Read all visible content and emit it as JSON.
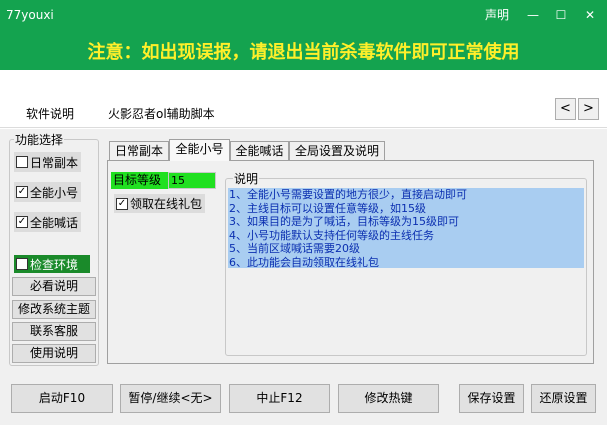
{
  "window": {
    "title": "77youxi",
    "controls": {
      "declaration": "声明",
      "minimize": "—",
      "maximize": "☐",
      "close": "✕"
    },
    "warning": "注意：如出现误报，请退出当前杀毒软件即可正常使用"
  },
  "main_tabs": [
    "软件说明",
    "火影忍者ol辅助脚本"
  ],
  "nav": {
    "prev": "<",
    "next": ">"
  },
  "sidebar": {
    "title": "功能选择",
    "checkboxes": [
      {
        "label": "日常副本",
        "checked": false
      },
      {
        "label": "全能小号",
        "checked": true
      },
      {
        "label": "全能喊话",
        "checked": true
      }
    ],
    "check_env": "检查环境",
    "buttons": [
      "必看说明",
      "修改系统主题",
      "联系客服",
      "使用说明"
    ]
  },
  "panel_tabs": [
    "日常副本",
    "全能小号",
    "全能喊话",
    "全局设置及说明"
  ],
  "active_tab": "全能小号",
  "content": {
    "level_label": "目标等级",
    "level_value": "15",
    "gift_label": "领取在线礼包",
    "gift_checked": true,
    "desc_title": "说明",
    "desc_lines": [
      "1、全能小号需要设置的地方很少，直接启动即可",
      "2、主线目标可以设置任意等级，如15级",
      "3、如果目的是为了喊话，目标等级为15级即可",
      "4、小号功能默认支持任何等级的主线任务",
      "5、当前区域喊话需要20级",
      "6、此功能会自动领取在线礼包"
    ]
  },
  "bottom_buttons": [
    "启动F10",
    "暂停/继续<无>",
    "中止F12",
    "修改热键",
    "保存设置",
    "还原设置"
  ],
  "colors": {
    "title_bg": "#14a34f",
    "warning_text": "#ffef2a",
    "level_bg": "#20e020",
    "desc_bg": "#a9cdf1",
    "desc_text": "#0b2fb0"
  }
}
